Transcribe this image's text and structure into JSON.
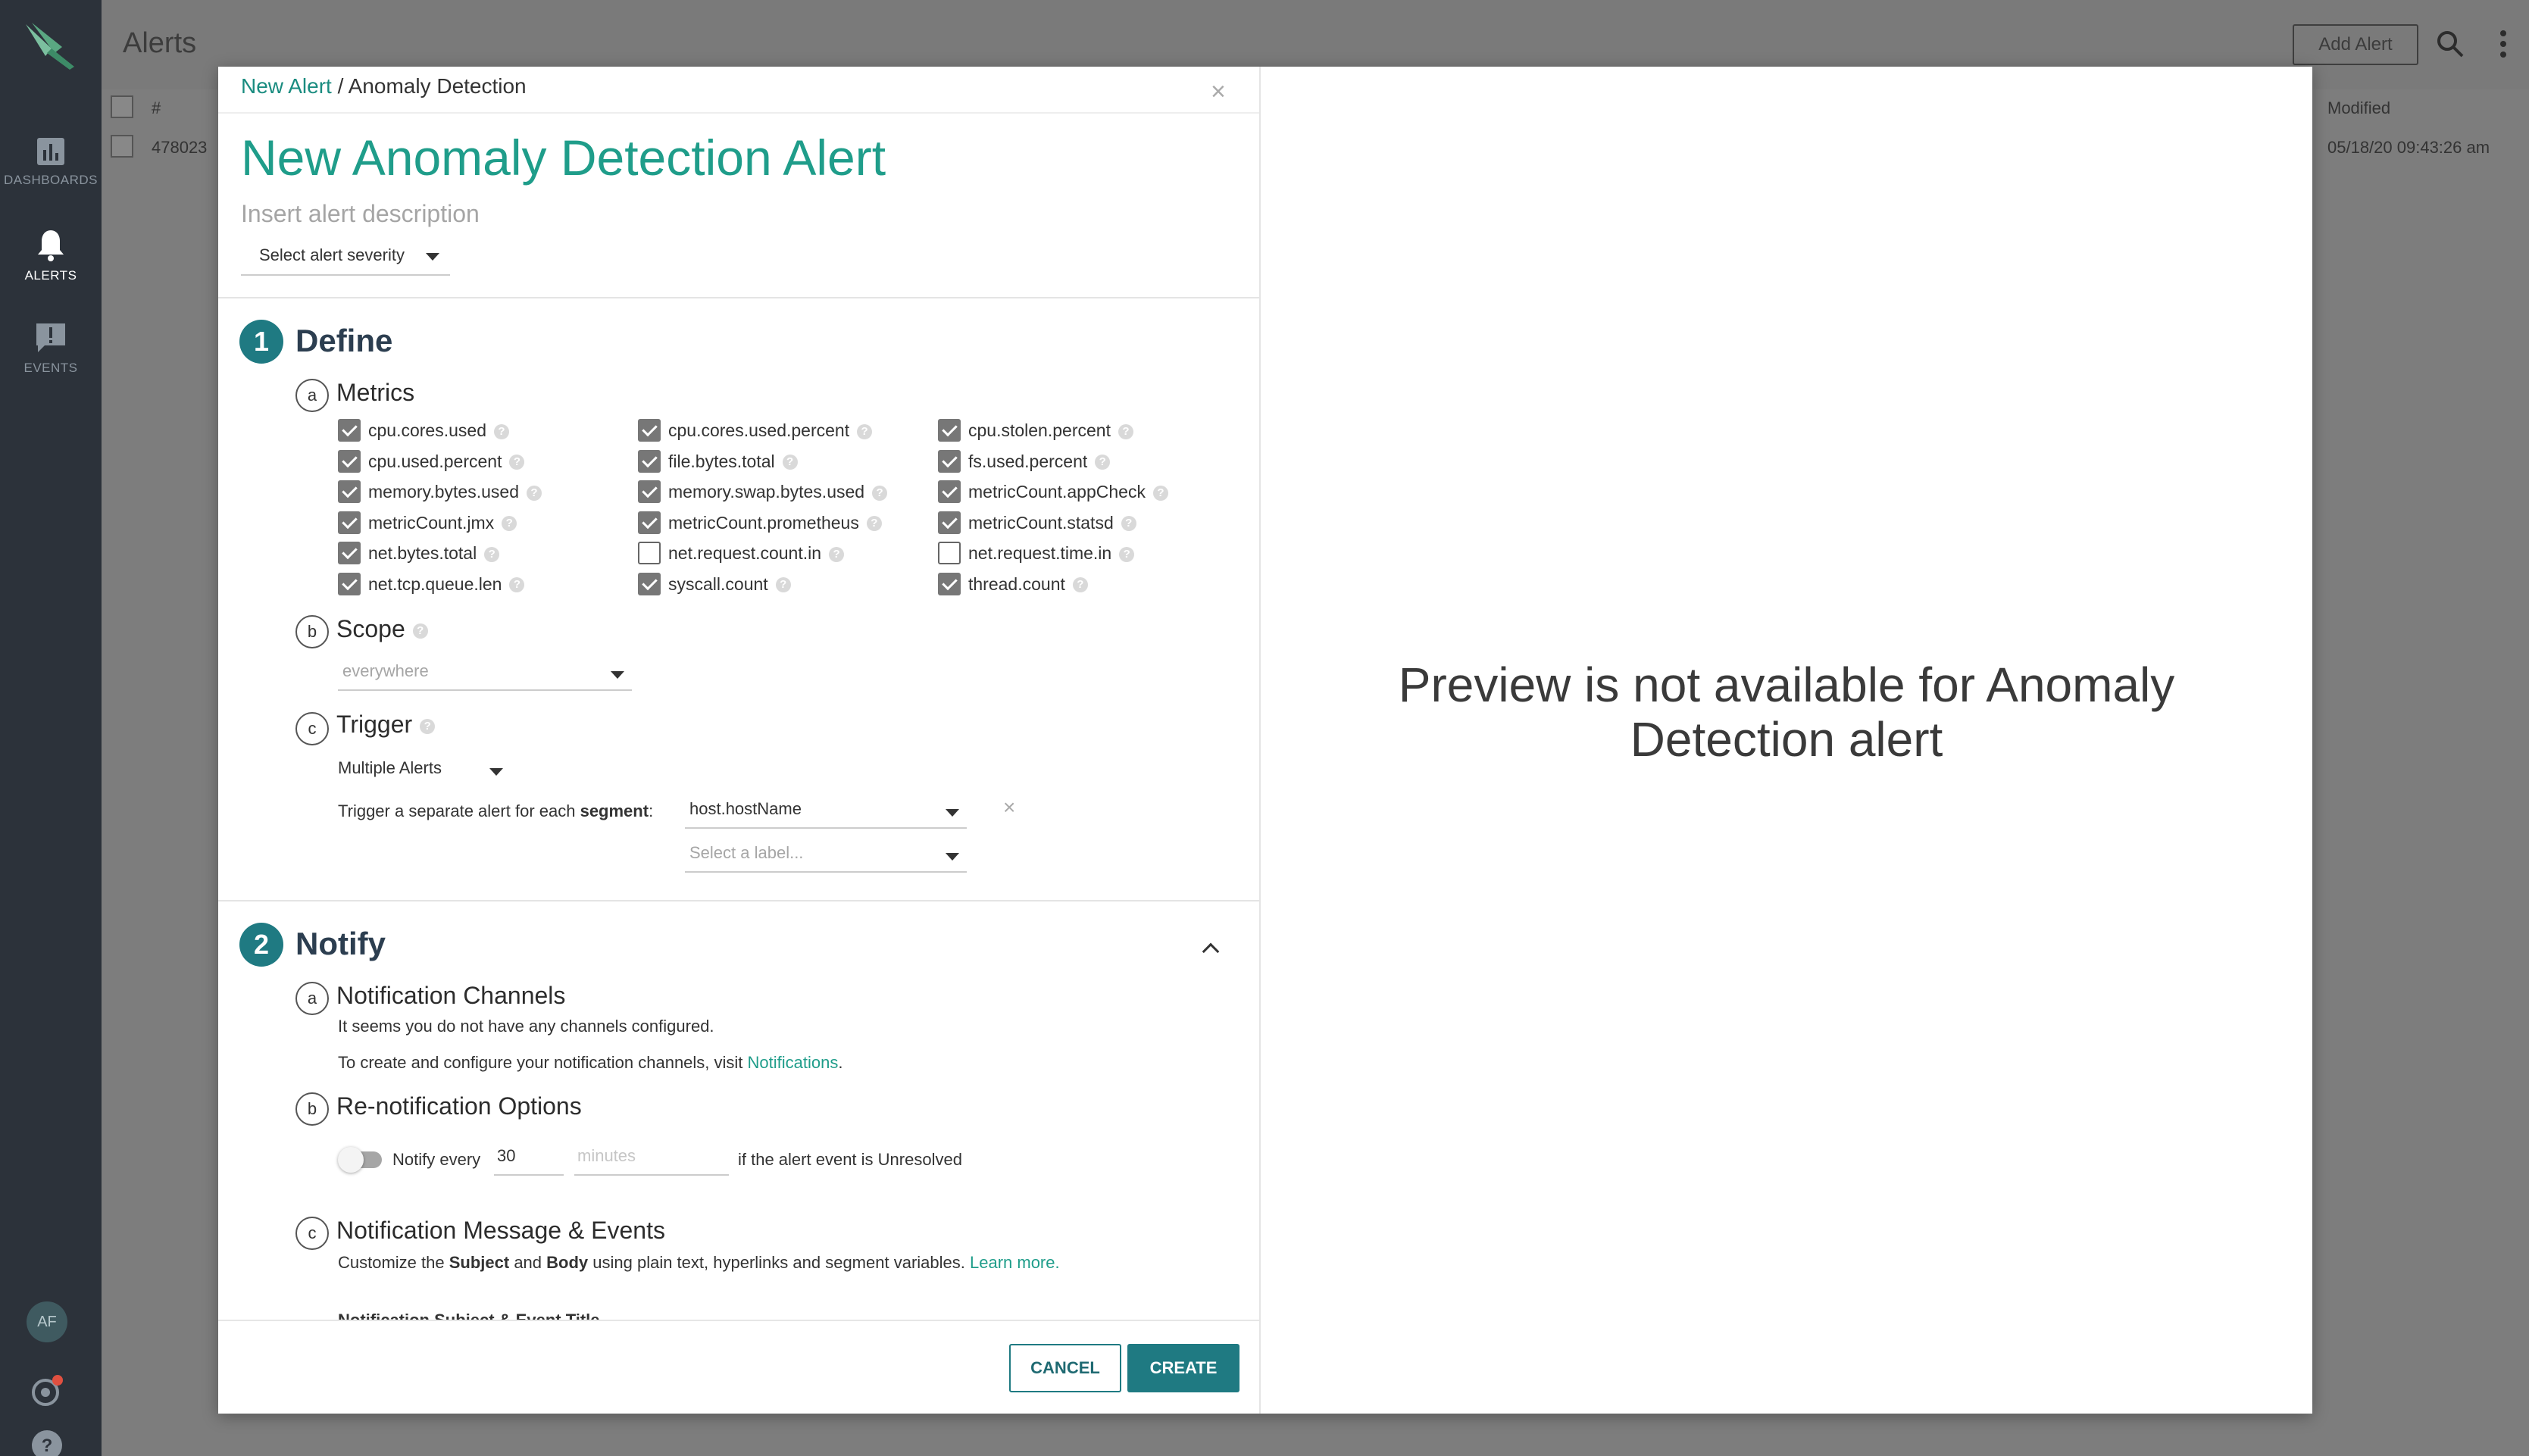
{
  "nav": {
    "items": [
      {
        "label": "DASHBOARDS",
        "icon": "bar-chart-icon"
      },
      {
        "label": "ALERTS",
        "icon": "bell-icon"
      },
      {
        "label": "EVENTS",
        "icon": "event-message-icon"
      }
    ],
    "avatar": "AF"
  },
  "page": {
    "title": "Alerts",
    "add_alert": "Add Alert",
    "table": {
      "col_num": "#",
      "col_modified": "Modified",
      "row": {
        "id": "478023",
        "modified": "05/18/20 09:43:26 am"
      }
    }
  },
  "modal": {
    "breadcrumb_link": "New Alert",
    "breadcrumb_sep": " / ",
    "breadcrumb_current": "Anomaly Detection",
    "close": "×",
    "title": "New Anomaly Detection Alert",
    "description_placeholder": "Insert alert description",
    "severity": "Select alert severity",
    "define": {
      "num": "1",
      "title": "Define",
      "metrics": {
        "letter": "a",
        "title": "Metrics",
        "items": [
          {
            "label": "cpu.cores.used",
            "checked": true
          },
          {
            "label": "cpu.used.percent",
            "checked": true
          },
          {
            "label": "memory.bytes.used",
            "checked": true
          },
          {
            "label": "metricCount.jmx",
            "checked": true
          },
          {
            "label": "net.bytes.total",
            "checked": true
          },
          {
            "label": "net.tcp.queue.len",
            "checked": true
          },
          {
            "label": "cpu.cores.used.percent",
            "checked": true
          },
          {
            "label": "file.bytes.total",
            "checked": true
          },
          {
            "label": "memory.swap.bytes.used",
            "checked": true
          },
          {
            "label": "metricCount.prometheus",
            "checked": true
          },
          {
            "label": "net.request.count.in",
            "checked": false
          },
          {
            "label": "syscall.count",
            "checked": true
          },
          {
            "label": "cpu.stolen.percent",
            "checked": true
          },
          {
            "label": "fs.used.percent",
            "checked": true
          },
          {
            "label": "metricCount.appCheck",
            "checked": true
          },
          {
            "label": "metricCount.statsd",
            "checked": true
          },
          {
            "label": "net.request.time.in",
            "checked": false
          },
          {
            "label": "thread.count",
            "checked": true
          }
        ]
      },
      "scope": {
        "letter": "b",
        "title": "Scope",
        "value": "everywhere"
      },
      "trigger": {
        "letter": "c",
        "title": "Trigger",
        "mode": "Multiple Alerts",
        "segment_prefix": "Trigger a separate alert for each ",
        "segment_bold": "segment",
        "segment_suffix": ":",
        "segment_value": "host.hostName",
        "label_placeholder": "Select a label...",
        "remove": "×"
      }
    },
    "notify": {
      "num": "2",
      "title": "Notify",
      "channels": {
        "letter": "a",
        "title": "Notification Channels",
        "line1": "It seems you do not have any channels configured.",
        "line2_prefix": "To create and configure your notification channels, visit ",
        "line2_link": "Notifications",
        "line2_suffix": "."
      },
      "renotify": {
        "letter": "b",
        "title": "Re-notification Options",
        "label": "Notify every",
        "value": "30",
        "unit_placeholder": "minutes",
        "suffix": "if the alert event is Unresolved"
      },
      "message": {
        "letter": "c",
        "title": "Notification Message & Events",
        "desc_1": "Customize the ",
        "desc_subject": "Subject",
        "desc_2": " and ",
        "desc_body": "Body",
        "desc_3": " using plain text, hyperlinks and segment variables. ",
        "desc_link": "Learn more.",
        "cutoff_label": "Notification Subject & Event Title"
      }
    },
    "buttons": {
      "cancel": "CANCEL",
      "create": "CREATE"
    },
    "preview": "Preview is not available for Anomaly Detection alert"
  },
  "colors": {
    "accent": "#1f9d8a",
    "primary_button": "#1f7a82",
    "nav_bg": "#2c323a"
  }
}
